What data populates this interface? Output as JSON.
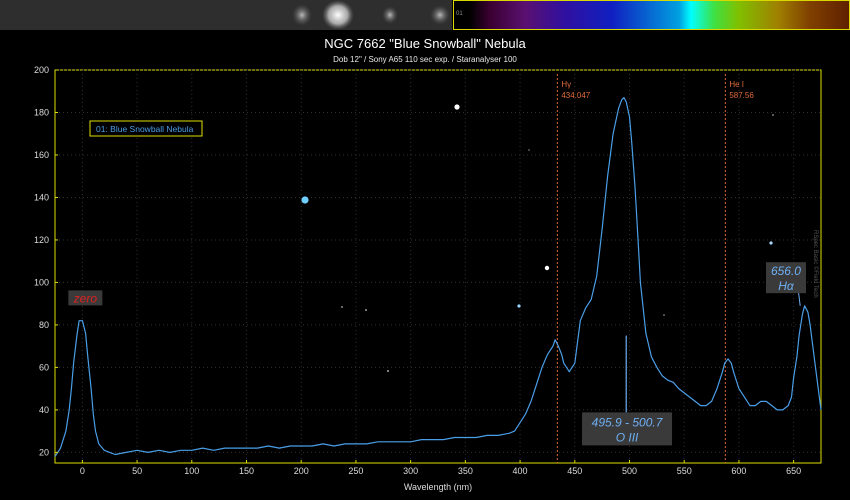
{
  "chart_data": {
    "type": "line",
    "title": "NGC 7662  \"Blue Snowball\" Nebula",
    "subtitle": "Dob 12\" / Sony A65 110 sec exp. / Staranalyser 100",
    "xlabel": "Wavelength (nm)",
    "ylabel": "",
    "xlim": [
      -25,
      675
    ],
    "ylim": [
      15,
      200
    ],
    "grid": true,
    "x_ticks": [
      0,
      50,
      100,
      150,
      200,
      250,
      300,
      350,
      400,
      450,
      500,
      550,
      600,
      650
    ],
    "y_ticks": [
      20,
      40,
      60,
      80,
      100,
      120,
      140,
      160,
      180,
      200
    ],
    "legend": {
      "label": "01: Blue Snowball Nebula",
      "position": "top-left"
    },
    "series": [
      {
        "name": "01: Blue Snowball Nebula",
        "color": "#4a9ee8",
        "x": [
          -25,
          -20,
          -15,
          -12,
          -10,
          -8,
          -5,
          -3,
          0,
          3,
          5,
          8,
          10,
          12,
          15,
          20,
          25,
          30,
          40,
          50,
          60,
          70,
          80,
          90,
          100,
          110,
          120,
          130,
          140,
          150,
          160,
          170,
          180,
          190,
          200,
          210,
          220,
          230,
          240,
          250,
          260,
          270,
          280,
          290,
          300,
          310,
          320,
          330,
          340,
          350,
          360,
          370,
          380,
          390,
          395,
          400,
          405,
          410,
          415,
          420,
          425,
          430,
          432,
          435,
          438,
          440,
          445,
          450,
          455,
          460,
          465,
          470,
          475,
          480,
          485,
          490,
          493,
          495,
          497,
          500,
          502,
          505,
          508,
          510,
          515,
          520,
          525,
          530,
          535,
          540,
          545,
          550,
          555,
          560,
          565,
          570,
          575,
          580,
          585,
          587,
          590,
          593,
          595,
          600,
          605,
          610,
          615,
          620,
          625,
          630,
          635,
          640,
          645,
          648,
          650,
          653,
          655,
          658,
          660,
          663,
          665,
          670,
          675
        ],
        "y": [
          18,
          22,
          30,
          40,
          50,
          62,
          75,
          82,
          82,
          76,
          65,
          50,
          38,
          30,
          24,
          21,
          20,
          19,
          20,
          21,
          20,
          21,
          20,
          21,
          21,
          22,
          21,
          22,
          22,
          22,
          22,
          23,
          22,
          23,
          23,
          23,
          24,
          23,
          24,
          24,
          24,
          25,
          25,
          25,
          25,
          26,
          26,
          26,
          27,
          27,
          27,
          28,
          28,
          29,
          30,
          34,
          38,
          44,
          52,
          60,
          66,
          70,
          73,
          70,
          66,
          62,
          58,
          62,
          82,
          88,
          92,
          103,
          125,
          150,
          170,
          182,
          186,
          187,
          185,
          178,
          166,
          145,
          118,
          100,
          76,
          65,
          60,
          56,
          54,
          53,
          50,
          48,
          46,
          44,
          42,
          42,
          44,
          50,
          58,
          62,
          64,
          62,
          58,
          50,
          46,
          42,
          42,
          44,
          44,
          42,
          40,
          40,
          42,
          46,
          55,
          65,
          75,
          85,
          89,
          86,
          80,
          60,
          40
        ]
      }
    ],
    "reference_lines": [
      {
        "label": "Hγ",
        "value_label": "434.047",
        "x": 434.047,
        "color": "#e06a3a"
      },
      {
        "label": "He I",
        "value_label": "587.56",
        "x": 587.56,
        "color": "#e06a3a"
      }
    ],
    "annotations": [
      {
        "id": "zero",
        "text": "zero",
        "x": 0,
        "y": 92,
        "color": "#e02020"
      },
      {
        "id": "oiii",
        "lines": [
          "495.9 - 500.7",
          "O III"
        ],
        "x": 495,
        "y": 36,
        "color": "#6fb0f5"
      },
      {
        "id": "halpha",
        "lines": [
          "656.0",
          "Hα"
        ],
        "x": 643,
        "y": 102,
        "color": "#6fb0f5"
      }
    ]
  },
  "watermark": "RSpec Basic ©Field Tech"
}
